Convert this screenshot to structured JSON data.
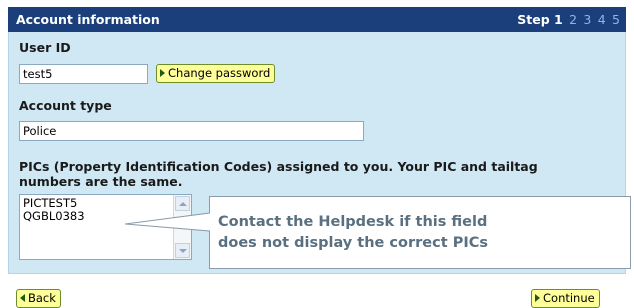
{
  "header": {
    "title": "Account information",
    "step_label": "Step",
    "current_step": "1",
    "other_steps": [
      "2",
      "3",
      "4",
      "5"
    ]
  },
  "user_id": {
    "label": "User ID",
    "value": "test5",
    "change_password_button": "Change password"
  },
  "account_type": {
    "label": "Account type",
    "value": "Police"
  },
  "pics": {
    "label_line1": "PICs (Property Identification Codes) assigned to you. Your PIC and tailtag",
    "label_line2": "numbers are the same.",
    "items": [
      "PICTEST5",
      "QGBL0383"
    ]
  },
  "callout": {
    "line1": "Contact the Helpdesk if this field",
    "line2": "does not display the correct PICs"
  },
  "footer": {
    "back_button": "Back",
    "continue_button": "Continue"
  },
  "colors": {
    "header_bg": "#1a3f7a",
    "panel_bg": "#cfe8f4",
    "button_bg": "#ffff99",
    "callout_text": "#5a7080"
  }
}
